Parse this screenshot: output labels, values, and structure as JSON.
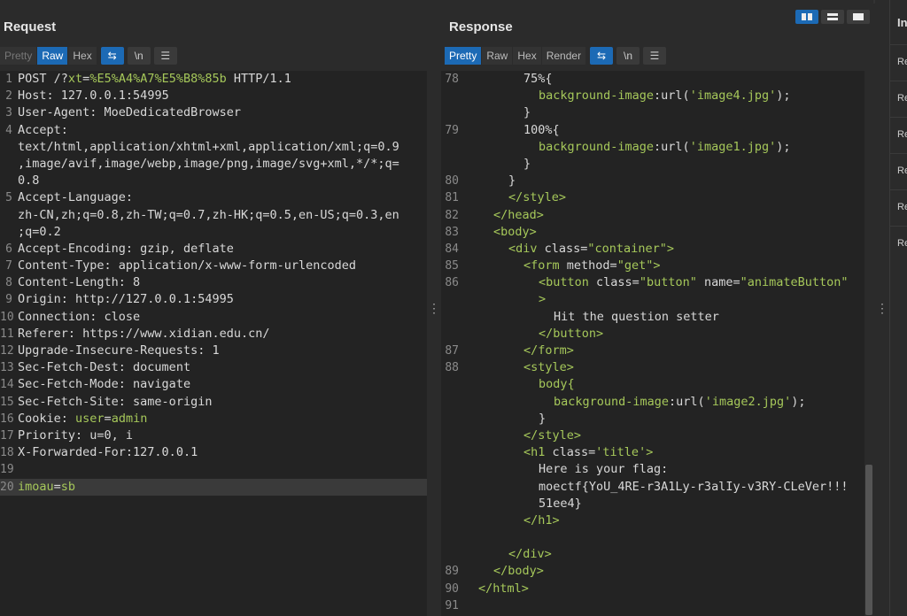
{
  "request": {
    "title": "Request",
    "tabs": [
      "Pretty",
      "Raw",
      "Hex"
    ],
    "active_tab": "Raw",
    "lines": [
      {
        "n": "1",
        "parts": [
          [
            "POST /?",
            "k"
          ],
          [
            "xt",
            "g"
          ],
          [
            "=",
            "k"
          ],
          [
            "%E5%A4%A7%E5%B8%85b",
            "g"
          ],
          [
            " HTTP/1.1",
            "k"
          ]
        ]
      },
      {
        "n": "2",
        "parts": [
          [
            "Host: ",
            "k"
          ],
          [
            "127.0.0.1:54995",
            "v"
          ]
        ]
      },
      {
        "n": "3",
        "parts": [
          [
            "User-Agent: ",
            "k"
          ],
          [
            "MoeDedicatedBrowser",
            "v"
          ]
        ]
      },
      {
        "n": "4",
        "parts": [
          [
            "Accept:",
            "k"
          ]
        ]
      },
      {
        "n": "",
        "parts": [
          [
            "text/html,application/xhtml+xml,application/xml;q=0.9",
            "v"
          ]
        ]
      },
      {
        "n": "",
        "parts": [
          [
            ",image/avif,image/webp,image/png,image/svg+xml,*/*;q=",
            "v"
          ]
        ]
      },
      {
        "n": "",
        "parts": [
          [
            "0.8",
            "v"
          ]
        ]
      },
      {
        "n": "5",
        "parts": [
          [
            "Accept-Language:",
            "k"
          ]
        ]
      },
      {
        "n": "",
        "parts": [
          [
            "zh-CN,zh;q=0.8,zh-TW;q=0.7,zh-HK;q=0.5,en-US;q=0.3,en",
            "v"
          ]
        ]
      },
      {
        "n": "",
        "parts": [
          [
            ";q=0.2",
            "v"
          ]
        ]
      },
      {
        "n": "6",
        "parts": [
          [
            "Accept-Encoding: ",
            "k"
          ],
          [
            "gzip, deflate",
            "v"
          ]
        ]
      },
      {
        "n": "7",
        "parts": [
          [
            "Content-Type: ",
            "k"
          ],
          [
            "application/x-www-form-urlencoded",
            "v"
          ]
        ]
      },
      {
        "n": "8",
        "parts": [
          [
            "Content-Length: ",
            "k"
          ],
          [
            "8",
            "v"
          ]
        ]
      },
      {
        "n": "9",
        "parts": [
          [
            "Origin: ",
            "k"
          ],
          [
            "http://127.0.0.1:54995",
            "v"
          ]
        ]
      },
      {
        "n": "10",
        "parts": [
          [
            "Connection: ",
            "k"
          ],
          [
            "close",
            "v"
          ]
        ]
      },
      {
        "n": "11",
        "parts": [
          [
            "Referer: ",
            "k"
          ],
          [
            "https://www.xidian.edu.cn/",
            "v"
          ]
        ]
      },
      {
        "n": "12",
        "parts": [
          [
            "Upgrade-Insecure-Requests: ",
            "k"
          ],
          [
            "1",
            "v"
          ]
        ]
      },
      {
        "n": "13",
        "parts": [
          [
            "Sec-Fetch-Dest: ",
            "k"
          ],
          [
            "document",
            "v"
          ]
        ]
      },
      {
        "n": "14",
        "parts": [
          [
            "Sec-Fetch-Mode: ",
            "k"
          ],
          [
            "navigate",
            "v"
          ]
        ]
      },
      {
        "n": "15",
        "parts": [
          [
            "Sec-Fetch-Site: ",
            "k"
          ],
          [
            "same-origin",
            "v"
          ]
        ]
      },
      {
        "n": "16",
        "parts": [
          [
            "Cookie: ",
            "k"
          ],
          [
            "user",
            "g"
          ],
          [
            "=",
            "k"
          ],
          [
            "admin",
            "g"
          ]
        ]
      },
      {
        "n": "17",
        "parts": [
          [
            "Priority: ",
            "k"
          ],
          [
            "u=0, i",
            "v"
          ]
        ]
      },
      {
        "n": "18",
        "parts": [
          [
            "X-Forwarded-For:",
            "k"
          ],
          [
            "127.0.0.1",
            "v"
          ]
        ]
      },
      {
        "n": "19",
        "parts": []
      },
      {
        "n": "20",
        "parts": [
          [
            "imoau",
            "g"
          ],
          [
            "=",
            "k"
          ],
          [
            "sb",
            "g"
          ]
        ],
        "highlight": true
      }
    ]
  },
  "response": {
    "title": "Response",
    "tabs": [
      "Pretty",
      "Raw",
      "Hex",
      "Render"
    ],
    "active_tab": "Pretty",
    "lines": [
      {
        "n": "78",
        "indent": 3,
        "parts": [
          [
            "75%{",
            "k"
          ]
        ]
      },
      {
        "n": "",
        "indent": 4,
        "parts": [
          [
            "background-image",
            "g"
          ],
          [
            ":url(",
            "k"
          ],
          [
            "'image4.jpg'",
            "g"
          ],
          [
            ");",
            "k"
          ]
        ]
      },
      {
        "n": "",
        "indent": 3,
        "parts": [
          [
            "}",
            "k"
          ]
        ]
      },
      {
        "n": "79",
        "indent": 3,
        "parts": [
          [
            "100%{",
            "k"
          ]
        ]
      },
      {
        "n": "",
        "indent": 4,
        "parts": [
          [
            "background-image",
            "g"
          ],
          [
            ":url(",
            "k"
          ],
          [
            "'image1.jpg'",
            "g"
          ],
          [
            ");",
            "k"
          ]
        ]
      },
      {
        "n": "",
        "indent": 3,
        "parts": [
          [
            "}",
            "k"
          ]
        ]
      },
      {
        "n": "80",
        "indent": 2,
        "parts": [
          [
            "}",
            "k"
          ]
        ]
      },
      {
        "n": "81",
        "indent": 2,
        "parts": [
          [
            "</style>",
            "g"
          ]
        ]
      },
      {
        "n": "82",
        "indent": 1,
        "parts": [
          [
            "</head>",
            "g"
          ]
        ]
      },
      {
        "n": "83",
        "indent": 1,
        "parts": [
          [
            "<body>",
            "g"
          ]
        ]
      },
      {
        "n": "84",
        "indent": 2,
        "parts": [
          [
            "<div ",
            "g"
          ],
          [
            "class=",
            "k"
          ],
          [
            "\"container\"",
            "g"
          ],
          [
            ">",
            "g"
          ]
        ]
      },
      {
        "n": "85",
        "indent": 3,
        "parts": [
          [
            "<form ",
            "g"
          ],
          [
            "method=",
            "k"
          ],
          [
            "\"get\"",
            "g"
          ],
          [
            ">",
            "g"
          ]
        ]
      },
      {
        "n": "86",
        "indent": 4,
        "parts": [
          [
            "<button ",
            "g"
          ],
          [
            "class=",
            "k"
          ],
          [
            "\"button\" ",
            "g"
          ],
          [
            "name=",
            "k"
          ],
          [
            "\"animateButton\"",
            "g"
          ]
        ]
      },
      {
        "n": "",
        "indent": 4,
        "parts": [
          [
            ">",
            "g"
          ]
        ]
      },
      {
        "n": "",
        "indent": 5,
        "parts": [
          [
            "Hit the question setter",
            "k"
          ]
        ]
      },
      {
        "n": "",
        "indent": 4,
        "parts": [
          [
            "</button>",
            "g"
          ]
        ]
      },
      {
        "n": "87",
        "indent": 3,
        "parts": [
          [
            "</form>",
            "g"
          ]
        ]
      },
      {
        "n": "88",
        "indent": 3,
        "parts": [
          [
            "<style>",
            "g"
          ]
        ]
      },
      {
        "n": "",
        "indent": 4,
        "parts": [
          [
            "body{",
            "g"
          ]
        ]
      },
      {
        "n": "",
        "indent": 5,
        "parts": [
          [
            "background-image",
            "g"
          ],
          [
            ":url(",
            "k"
          ],
          [
            "'image2.jpg'",
            "g"
          ],
          [
            ");",
            "k"
          ]
        ]
      },
      {
        "n": "",
        "indent": 4,
        "parts": [
          [
            "}",
            "k"
          ]
        ]
      },
      {
        "n": "",
        "indent": 3,
        "parts": [
          [
            "</style>",
            "g"
          ]
        ]
      },
      {
        "n": "",
        "indent": 3,
        "parts": [
          [
            "<h1 ",
            "g"
          ],
          [
            "class=",
            "k"
          ],
          [
            "'title'",
            "g"
          ],
          [
            ">",
            "g"
          ]
        ]
      },
      {
        "n": "",
        "indent": 4,
        "parts": [
          [
            "Here is your flag:",
            "k"
          ]
        ]
      },
      {
        "n": "",
        "indent": 4,
        "parts": [
          [
            "moectf{YoU_4RE-r3A1Ly-r3alIy-v3RY-CLeVer!!!",
            "k"
          ]
        ]
      },
      {
        "n": "",
        "indent": 4,
        "parts": [
          [
            "51ee4}",
            "k"
          ]
        ]
      },
      {
        "n": "",
        "indent": 3,
        "parts": [
          [
            "</h1>",
            "g"
          ]
        ]
      },
      {
        "n": "",
        "indent": 0,
        "parts": []
      },
      {
        "n": "",
        "indent": 2,
        "parts": [
          [
            "</div>",
            "g"
          ]
        ]
      },
      {
        "n": "89",
        "indent": 1,
        "parts": [
          [
            "</body>",
            "g"
          ]
        ]
      },
      {
        "n": "90",
        "indent": 0,
        "parts": [
          [
            "</html>",
            "g"
          ]
        ]
      },
      {
        "n": "91",
        "indent": 0,
        "parts": []
      }
    ]
  },
  "side": {
    "title": "In",
    "items": [
      "Re",
      "Re",
      "Re",
      "Re",
      "Re",
      "Re"
    ]
  },
  "icons": {
    "wrap": "wrap-lines-icon",
    "newline": "newline-icon",
    "menu": "menu-icon",
    "drag": "drag-handle-icon"
  },
  "colors": {
    "accent": "#1c6ab5",
    "string": "#a6c85a",
    "background": "#232323"
  }
}
